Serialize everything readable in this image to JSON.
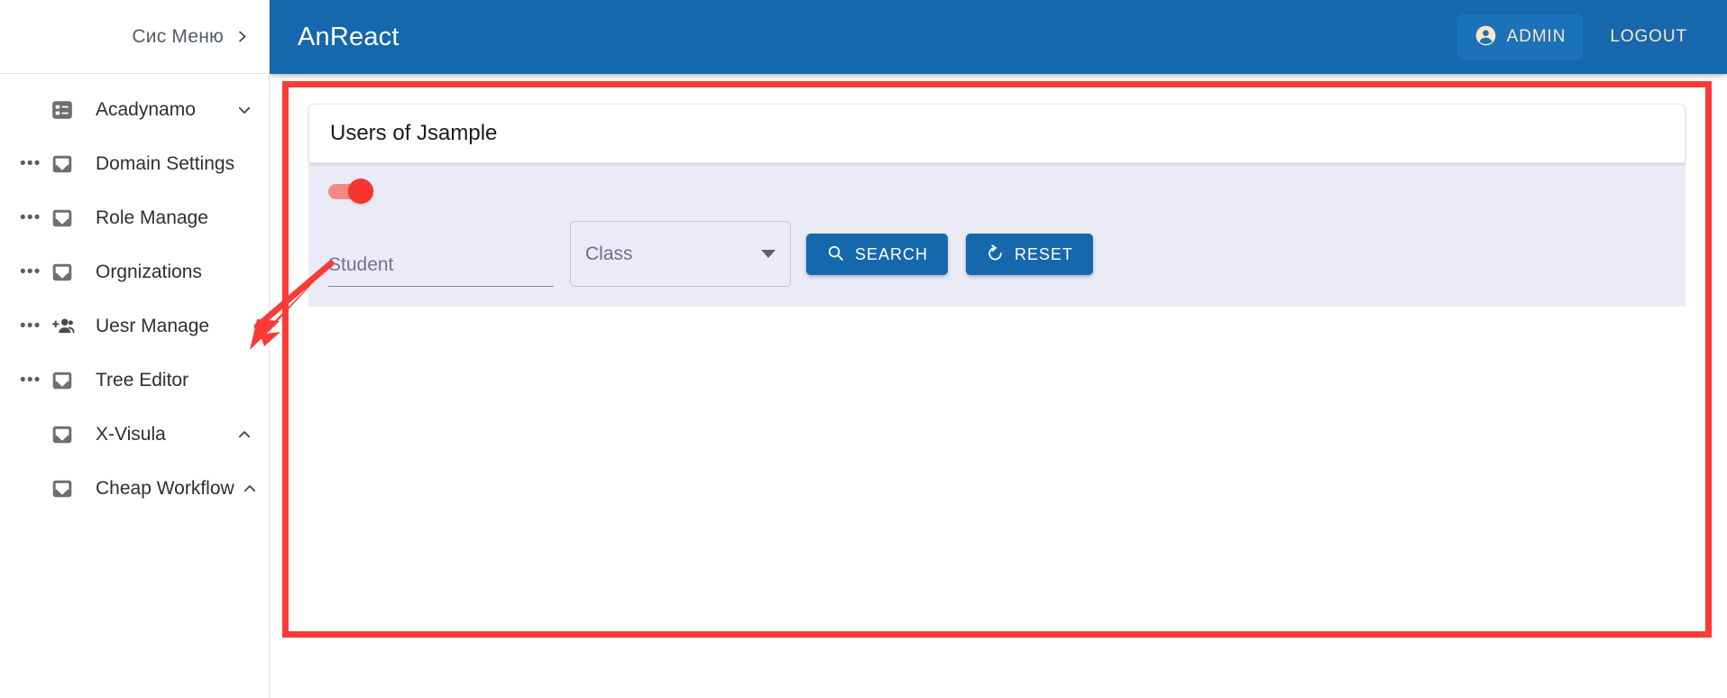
{
  "sidebar": {
    "header": {
      "label": "Сис Меню",
      "chevron_icon": "chevron-right-icon"
    },
    "items": [
      {
        "label": "Acadynamo",
        "icon": "list-grid-icon",
        "dots": false,
        "chevron": "chevron-down-icon"
      },
      {
        "label": "Domain Settings",
        "icon": "window-icon",
        "dots": true,
        "chevron": ""
      },
      {
        "label": "Role Manage",
        "icon": "window-icon",
        "dots": true,
        "chevron": ""
      },
      {
        "label": "Orgnizations",
        "icon": "window-icon",
        "dots": true,
        "chevron": ""
      },
      {
        "label": "Uesr Manage",
        "icon": "person-add-icon",
        "dots": true,
        "chevron": ""
      },
      {
        "label": "Tree Editor",
        "icon": "window-icon",
        "dots": true,
        "chevron": ""
      },
      {
        "label": "X-Visula",
        "icon": "window-icon",
        "dots": false,
        "chevron": "chevron-up-icon"
      },
      {
        "label": "Cheap Workflow",
        "icon": "window-icon",
        "dots": false,
        "chevron": "chevron-up-icon"
      }
    ]
  },
  "topbar": {
    "app_title": "AnReact",
    "admin_label": "ADMIN",
    "admin_icon": "account-circle-icon",
    "logout_label": "LOGOUT"
  },
  "card": {
    "title": "Users of Jsample"
  },
  "search_form": {
    "toggle": {
      "name": "record-toggle",
      "state": "on"
    },
    "student_placeholder": "Student",
    "student_value": "",
    "class_selected": "Class",
    "class_options": [
      "Class"
    ],
    "search_label": "SEARCH",
    "search_icon": "magnifier-icon",
    "reset_label": "RESET",
    "reset_icon": "restore-icon"
  },
  "annotations": {
    "highlight_color": "#fa3a35",
    "arrow_target": "Uesr Manage"
  },
  "colors": {
    "primary": "#1668ad",
    "accent_cream": "#fbe7c8",
    "toggle_on": "#f4362f",
    "panel_bg": "#ebebf8"
  }
}
